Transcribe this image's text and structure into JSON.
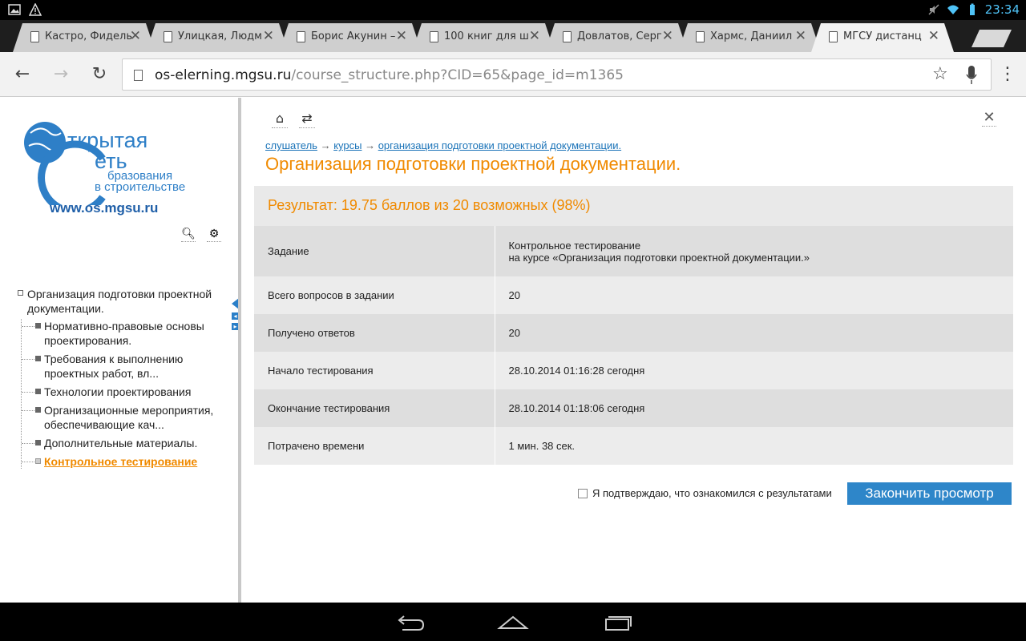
{
  "status": {
    "time": "23:34"
  },
  "tabs": [
    {
      "label": "Кастро, Фидель"
    },
    {
      "label": "Улицкая, Людм"
    },
    {
      "label": "Борис Акунин –"
    },
    {
      "label": "100 книг для ш"
    },
    {
      "label": "Довлатов, Серг"
    },
    {
      "label": "Хармс, Даниил"
    },
    {
      "label": "МГСУ дистанц"
    }
  ],
  "url": {
    "host": "os-elerning.mgsu.ru",
    "path": "/course_structure.php?CID=65&page_id=m1365"
  },
  "sidebar": {
    "logo_line1": "ткрытая",
    "logo_line2": "еть",
    "logo_line3": "бразования",
    "logo_line4": "в строительстве",
    "logo_url": "www.os.mgsu.ru",
    "tree_root": "Организация подготовки проектной документации.",
    "items": [
      {
        "label": "Нормативно-правовые основы проектирования."
      },
      {
        "label": "Требования к выполнению проектных работ, вл..."
      },
      {
        "label": "Технологии проектирования"
      },
      {
        "label": "Организационные мероприятия, обеспечивающие кач..."
      },
      {
        "label": "Дополнительные материалы."
      },
      {
        "label": "Контрольное тестирование"
      }
    ]
  },
  "breadcrumb": {
    "c1": "слушатель",
    "c2": "курсы",
    "c3": "организация подготовки проектной документации.",
    "sep": "→"
  },
  "page_title": "Организация подготовки проектной документации.",
  "result": "Результат: 19.75 баллов из 20 возможных (98%)",
  "rows": [
    {
      "k": "Задание",
      "v1": "Контрольное тестирование",
      "v2": "на курсе «Организация подготовки проектной документации.»"
    },
    {
      "k": "Всего вопросов в задании",
      "v1": "20"
    },
    {
      "k": "Получено ответов",
      "v1": "20"
    },
    {
      "k": "Начало тестирования",
      "v1": "28.10.2014 01:16:28 сегодня"
    },
    {
      "k": "Окончание тестирования",
      "v1": "28.10.2014 01:18:06 сегодня"
    },
    {
      "k": "Потрачено времени",
      "v1": "1 мин. 38 сек."
    }
  ],
  "confirm_label": "Я подтверждаю, что ознакомился с результатами",
  "finish_button": "Закончить просмотр",
  "colors": {
    "accent_orange": "#f08a00",
    "link_blue": "#1a73b8",
    "button_blue": "#2e86c9"
  }
}
